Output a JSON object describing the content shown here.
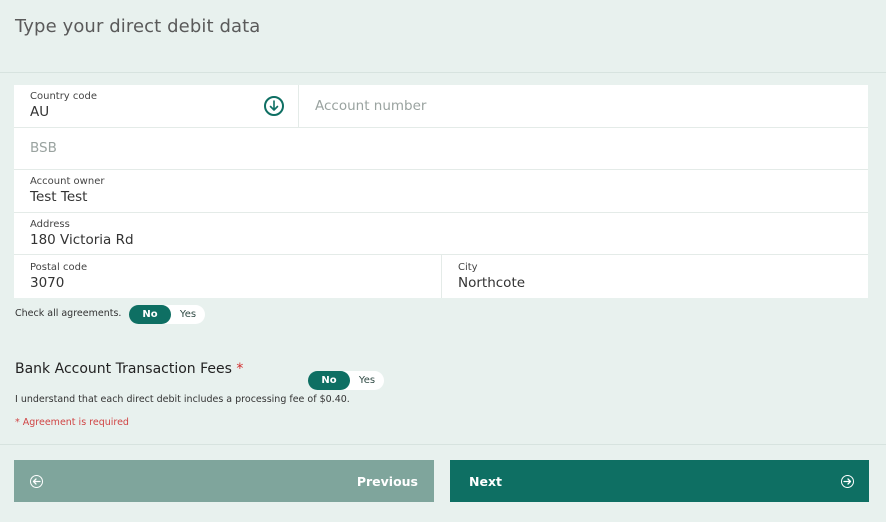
{
  "page": {
    "title": "Type your direct debit data"
  },
  "form": {
    "country_code": {
      "label": "Country code",
      "value": "AU",
      "icon": "chevron-down-circle-icon"
    },
    "account_number": {
      "placeholder": "Account number"
    },
    "bsb": {
      "placeholder": "BSB"
    },
    "account_owner": {
      "label": "Account owner",
      "value": "Test Test"
    },
    "address": {
      "label": "Address",
      "value": "180 Victoria Rd"
    },
    "postal_code": {
      "label": "Postal code",
      "value": "3070"
    },
    "city": {
      "label": "City",
      "value": "Northcote"
    }
  },
  "agreements": {
    "check_all_label": "Check all agreements.",
    "check_all_toggle": {
      "no": "No",
      "yes": "Yes",
      "selected": "No"
    }
  },
  "fees": {
    "title": "Bank Account Transaction Fees",
    "required_marker": "*",
    "description": "I understand that each direct debit includes a processing fee of $0.40.",
    "toggle": {
      "no": "No",
      "yes": "Yes",
      "selected": "No"
    },
    "error": "* Agreement is required"
  },
  "nav": {
    "previous_label": "Previous",
    "next_label": "Next",
    "previous_icon": "arrow-left-circle-icon",
    "next_icon": "arrow-right-circle-icon"
  },
  "colors": {
    "accent": "#0e6f63",
    "secondary_button": "#7fa59c",
    "background": "#e8f1ee",
    "error": "#d04545"
  }
}
